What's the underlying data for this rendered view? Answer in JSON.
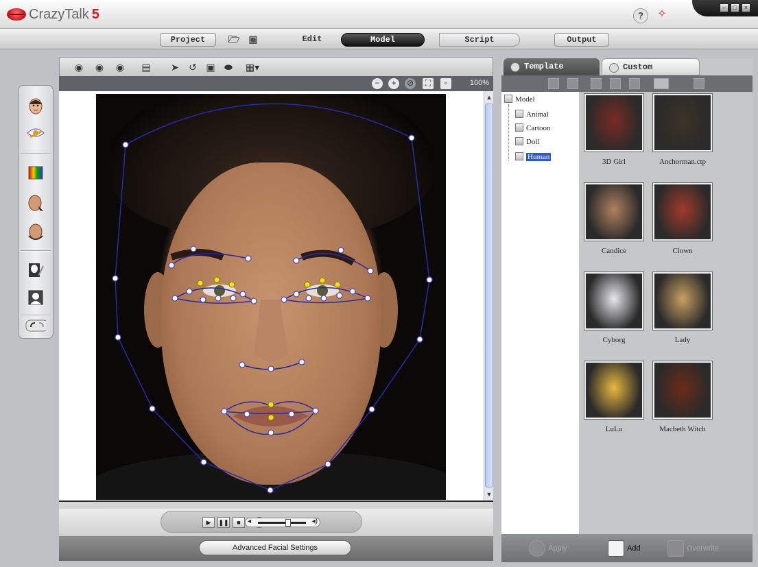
{
  "app": {
    "name": "CrazyTalk",
    "version": "5"
  },
  "titlebar": {
    "help_icon": "?",
    "wand_icon": "magic-wand-icon"
  },
  "window_controls": [
    "minimize",
    "restore",
    "close"
  ],
  "menu": {
    "project": "Project",
    "edit": "Edit",
    "model": "Model",
    "script": "Script",
    "output": "Output"
  },
  "viewer": {
    "zoom": "100%",
    "toolbar_icons": [
      "eye-front-icon",
      "eye-side-icon",
      "eye-back-icon",
      "page-icon",
      "arrow-icon",
      "rotate-icon",
      "save-frame-icon",
      "mouth-icon",
      "image-dropdown-icon"
    ],
    "zoom_icons": [
      "zoom-out-icon",
      "zoom-in-icon",
      "reset-icon",
      "fit-icon",
      "actual-size-icon"
    ]
  },
  "left_tools": [
    "face-fit-icon",
    "eye-brush-icon",
    "color-palette-icon",
    "head-select-icon",
    "head-rotate-icon",
    "mask-brush-icon",
    "profile-icon",
    "undo-redo-icon"
  ],
  "playback": {
    "volume_level": 0.7
  },
  "buttons": {
    "advanced_facial_settings": "Advanced Facial Settings"
  },
  "right_panel": {
    "tabs": {
      "template": "Template",
      "custom": "Custom"
    },
    "tree": {
      "root": "Model",
      "children": [
        "Animal",
        "Cartoon",
        "Doll",
        "Human"
      ],
      "selected": "Human"
    },
    "templates": [
      {
        "label": "3D Girl",
        "color": "#7a2a24"
      },
      {
        "label": "Anchorman.ctp",
        "color": "#3b3326"
      },
      {
        "label": "Candice",
        "color": "#b08060"
      },
      {
        "label": "Clown",
        "color": "#a23a2a"
      },
      {
        "label": "Cyborg",
        "color": "#e8e8ee"
      },
      {
        "label": "Lady",
        "color": "#c8a060"
      },
      {
        "label": "LuLu",
        "color": "#e8b840"
      },
      {
        "label": "Macbeth Witch",
        "color": "#6a2a18"
      }
    ],
    "actions": {
      "apply": "Apply",
      "add": "Add",
      "overwrite": "Overwrite"
    }
  }
}
